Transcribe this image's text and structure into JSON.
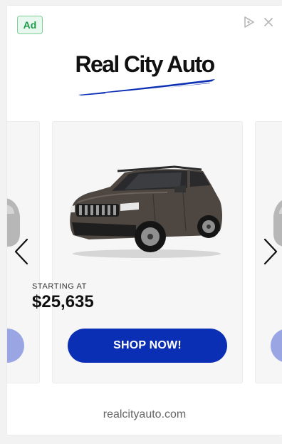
{
  "ad": {
    "badge_label": "Ad",
    "brand_name": "Real City Auto",
    "brand_color": "#0b2fb4",
    "domain": "realcityauto.com",
    "icons": {
      "adchoices": "adchoices-icon",
      "close": "close-icon",
      "prev": "chevron-left-icon",
      "next": "chevron-right-icon",
      "brand_mark": "swoosh-icon"
    }
  },
  "carousel": {
    "current": {
      "starting_label": "STARTING AT",
      "price": "$25,635",
      "cta_label": "SHOP NOW!",
      "cta_color": "#0b2fb4"
    }
  }
}
